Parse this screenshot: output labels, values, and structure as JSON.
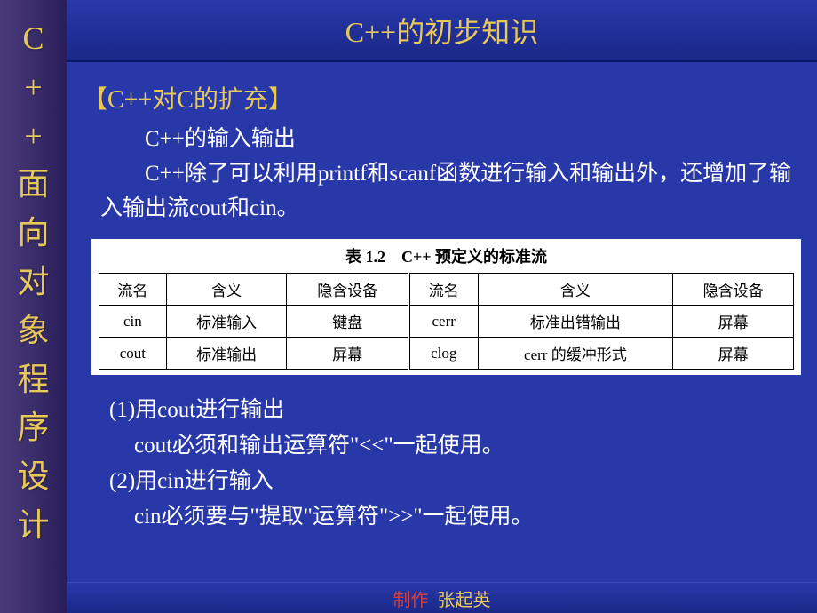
{
  "sidebar": {
    "chars": [
      "C",
      "+",
      "+",
      "面",
      "向",
      "对",
      "象",
      "程",
      "序",
      "设",
      "计"
    ]
  },
  "title": "C++的初步知识",
  "section": {
    "header": "【C++对C的扩充】",
    "line1": "C++的输入输出",
    "line2": "C++除了可以利用printf和scanf函数进行输入和输出外，还增加了输入输出流cout和cin。"
  },
  "table": {
    "caption": "表 1.2　C++ 预定义的标准流",
    "headers": [
      "流名",
      "含义",
      "隐含设备",
      "流名",
      "含义",
      "隐含设备"
    ],
    "rows": [
      [
        "cin",
        "标准输入",
        "键盘",
        "cerr",
        "标准出错输出",
        "屏幕"
      ],
      [
        "cout",
        "标准输出",
        "屏幕",
        "clog",
        "cerr 的缓冲形式",
        "屏幕"
      ]
    ]
  },
  "points": {
    "p1": "(1)用cout进行输出",
    "p1sub": "cout必须和输出运算符\"<<\"一起使用。",
    "p2": "(2)用cin进行输入",
    "p2sub": "cin必须要与\"提取\"运算符\">>\"一起使用。"
  },
  "footer": {
    "label": "制作",
    "name": "张起英"
  }
}
